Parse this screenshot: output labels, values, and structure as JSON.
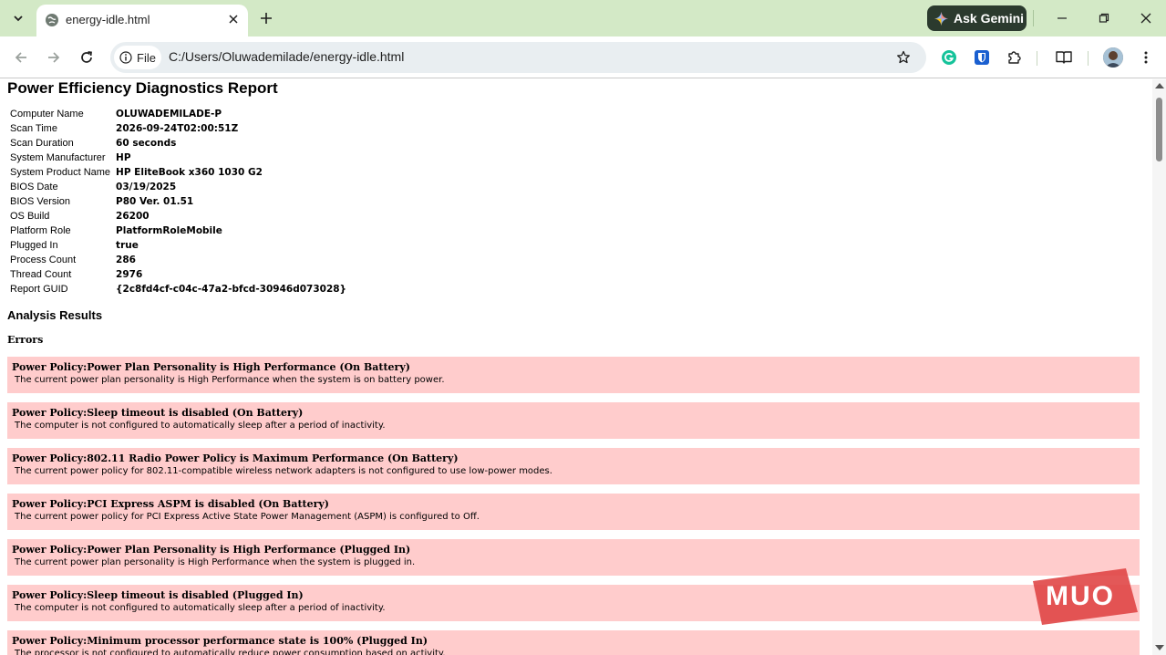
{
  "browser": {
    "tab_title": "energy-idle.html",
    "gemini_label": "Ask Gemini",
    "site_chip_label": "File",
    "url": "C:/Users/Oluwademilade/energy-idle.html"
  },
  "report": {
    "title": "Power Efficiency Diagnostics Report",
    "info": [
      {
        "label": "Computer Name",
        "value": "OLUWADEMILADE-P"
      },
      {
        "label": "Scan Time",
        "value": "2026-09-24T02:00:51Z"
      },
      {
        "label": "Scan Duration",
        "value": "60 seconds"
      },
      {
        "label": "System Manufacturer",
        "value": "HP"
      },
      {
        "label": "System Product Name",
        "value": "HP EliteBook x360 1030 G2"
      },
      {
        "label": "BIOS Date",
        "value": "03/19/2025"
      },
      {
        "label": "BIOS Version",
        "value": "P80 Ver. 01.51"
      },
      {
        "label": "OS Build",
        "value": "26200"
      },
      {
        "label": "Platform Role",
        "value": "PlatformRoleMobile"
      },
      {
        "label": "Plugged In",
        "value": "true"
      },
      {
        "label": "Process Count",
        "value": "286"
      },
      {
        "label": "Thread Count",
        "value": "2976"
      },
      {
        "label": "Report GUID",
        "value": "{2c8fd4cf-c04c-47a2-bfcd-30946d073028}"
      }
    ],
    "analysis_title": "Analysis Results",
    "errors_title": "Errors",
    "errors": [
      {
        "title": "Power Policy:Power Plan Personality is High Performance (On Battery)",
        "desc": "The current power plan personality is High Performance when the system is on battery power."
      },
      {
        "title": "Power Policy:Sleep timeout is disabled (On Battery)",
        "desc": "The computer is not configured to automatically sleep after a period of inactivity."
      },
      {
        "title": "Power Policy:802.11 Radio Power Policy is Maximum Performance (On Battery)",
        "desc": "The current power policy for 802.11-compatible wireless network adapters is not configured to use low-power modes."
      },
      {
        "title": "Power Policy:PCI Express ASPM is disabled (On Battery)",
        "desc": "The current power policy for PCI Express Active State Power Management (ASPM) is configured to Off."
      },
      {
        "title": "Power Policy:Power Plan Personality is High Performance (Plugged In)",
        "desc": "The current power plan personality is High Performance when the system is plugged in."
      },
      {
        "title": "Power Policy:Sleep timeout is disabled (Plugged In)",
        "desc": "The computer is not configured to automatically sleep after a period of inactivity."
      },
      {
        "title": "Power Policy:Minimum processor performance state is 100% (Plugged In)",
        "desc": "The processor is not configured to automatically reduce power consumption based on activity."
      }
    ]
  },
  "watermark": {
    "text": "MUO"
  },
  "colors": {
    "tabstrip": "#d3e9c6",
    "error_row": "#ffcccc",
    "watermark": "#e04646"
  }
}
